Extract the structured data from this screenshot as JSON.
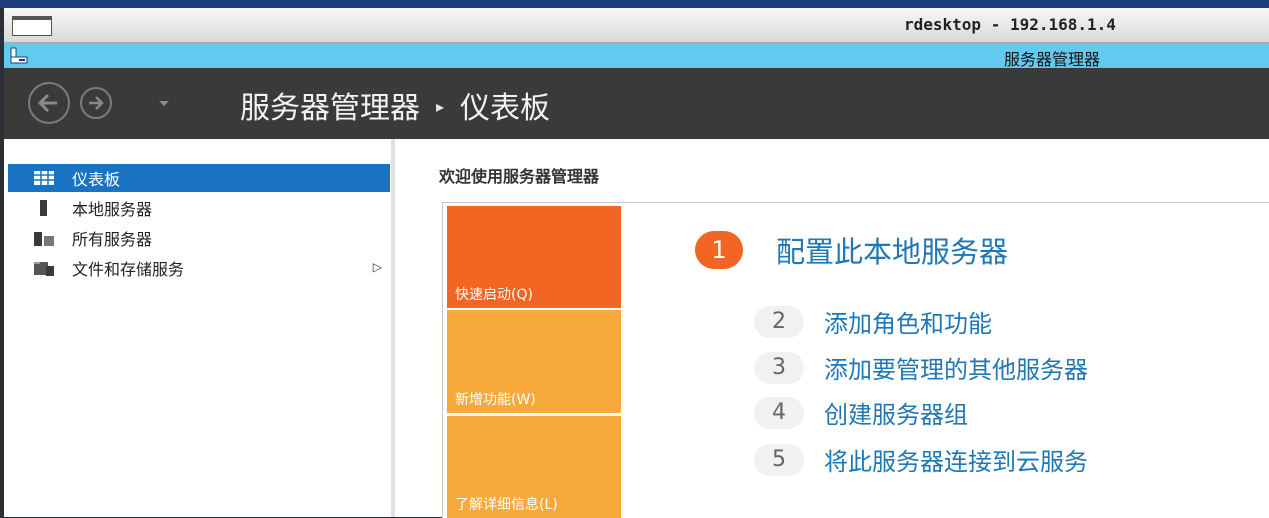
{
  "window": {
    "title": "rdesktop - 192.168.1.4"
  },
  "app": {
    "title": "服务器管理器"
  },
  "header": {
    "breadcrumb_root": "服务器管理器",
    "breadcrumb_separator": "▸",
    "breadcrumb_current": "仪表板"
  },
  "sidebar": {
    "items": [
      {
        "label": "仪表板",
        "icon": "dashboard-icon",
        "active": true
      },
      {
        "label": "本地服务器",
        "icon": "local-server-icon",
        "active": false
      },
      {
        "label": "所有服务器",
        "icon": "all-servers-icon",
        "active": false
      },
      {
        "label": "文件和存储服务",
        "icon": "file-storage-icon",
        "active": false,
        "expand_arrow": "▷"
      }
    ]
  },
  "main": {
    "welcome": "欢迎使用服务器管理器",
    "tiles": [
      {
        "label": "快速启动(Q)",
        "color": "#f26522"
      },
      {
        "label": "新增功能(W)",
        "color": "#f7a93b"
      },
      {
        "label": "了解详细信息(L)",
        "color": "#f7a93b"
      }
    ],
    "steps": [
      {
        "num": "1",
        "label": "配置此本地服务器"
      },
      {
        "num": "2",
        "label": "添加角色和功能"
      },
      {
        "num": "3",
        "label": "添加要管理的其他服务器"
      },
      {
        "num": "4",
        "label": "创建服务器组"
      },
      {
        "num": "5",
        "label": "将此服务器连接到云服务"
      }
    ]
  },
  "colors": {
    "accent_blue": "#1a73c2",
    "link_blue": "#1f78b4",
    "orange": "#f26522",
    "light_orange": "#f7a93b",
    "header_bg": "#3a3a3a",
    "appbar_bg": "#64c9ee"
  }
}
